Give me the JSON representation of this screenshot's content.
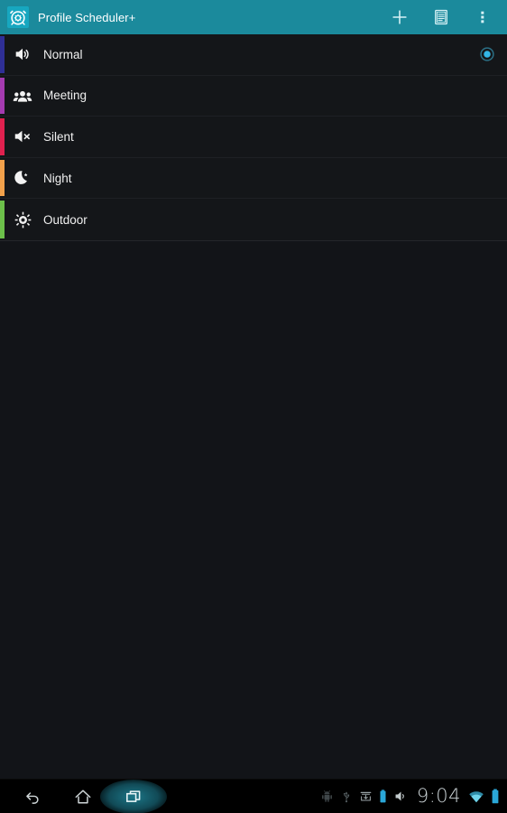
{
  "app": {
    "title": "Profile Scheduler+",
    "icon": "alarm-clock-gear-icon",
    "accent_color": "#1b8a9c"
  },
  "action_bar": {
    "background_color": "#1b8a9c",
    "buttons": [
      {
        "name": "add-profile-button",
        "icon": "plus-icon",
        "label": "+"
      },
      {
        "name": "profile-log-button",
        "icon": "list-document-icon",
        "label": ""
      },
      {
        "name": "overflow-menu-button",
        "icon": "more-vertical-icon",
        "label": ""
      }
    ]
  },
  "profiles": [
    {
      "label": "Normal",
      "icon": "speaker-volume-icon",
      "color": "#2f2f96",
      "selected": true
    },
    {
      "label": "Meeting",
      "icon": "people-group-icon",
      "color": "#a43bb0",
      "selected": false
    },
    {
      "label": "Silent",
      "icon": "speaker-mute-icon",
      "color": "#e0214f",
      "selected": false
    },
    {
      "label": "Night",
      "icon": "crescent-moon-star-icon",
      "color": "#f2a14b",
      "selected": false
    },
    {
      "label": "Outdoor",
      "icon": "sun-icon",
      "color": "#6cc04a",
      "selected": false
    }
  ],
  "selected_profile": "Normal",
  "radio": {
    "selected_color": "#33b5e5"
  },
  "nav_bar": {
    "buttons": [
      {
        "name": "back-button",
        "icon": "back-arrow-icon",
        "active": false
      },
      {
        "name": "home-button",
        "icon": "home-icon",
        "active": false
      },
      {
        "name": "recents-button",
        "icon": "recent-apps-icon",
        "active": true
      }
    ]
  },
  "status_bar": {
    "time": "9:04",
    "icons": [
      {
        "name": "android-debug-icon",
        "icon": "android-debug-icon"
      },
      {
        "name": "usb-icon",
        "icon": "usb-icon"
      },
      {
        "name": "download-icon",
        "icon": "download-tray-icon"
      },
      {
        "name": "battery-small-icon",
        "icon": "battery-icon"
      },
      {
        "name": "volume-icon",
        "icon": "speaker-volume-icon"
      }
    ],
    "trailing_icons": [
      {
        "name": "wifi-icon",
        "icon": "wifi-icon"
      },
      {
        "name": "battery-icon",
        "icon": "battery-icon"
      }
    ]
  }
}
